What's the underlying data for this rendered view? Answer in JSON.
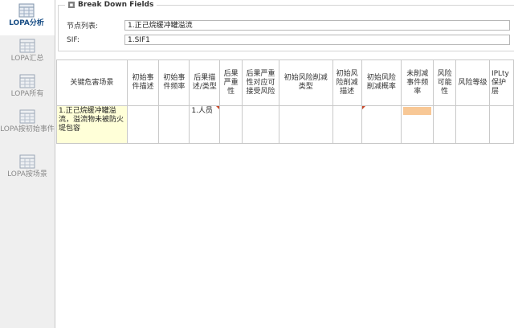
{
  "sidebar": {
    "items": [
      {
        "label": "LOPA分析"
      },
      {
        "label": "LOPA汇总"
      },
      {
        "label": "LOPA所有"
      },
      {
        "label": "LOPA按初始事件"
      },
      {
        "label": "LOPA按场景"
      }
    ]
  },
  "panel": {
    "title": "Break Down Fields",
    "collapse_glyph": "▪",
    "node_label": "节点列表:",
    "node_value": "1.正己烷缓冲罐溢流",
    "sif_label": "SIF:",
    "sif_value": "1.SIF1"
  },
  "table": {
    "headers": [
      "关键危害场景",
      "初始事件描述",
      "初始事件频率",
      "后果描述/类型",
      "后果严重性",
      "后果严重性对应可接受风险",
      "初始风险削减类型",
      "初始风险削减描述",
      "初始风险削减概率",
      "未削减事件频率",
      "风险可能性",
      "风险等级",
      "IPLty保护层"
    ],
    "row": {
      "scenario": "1.正己烷缓冲罐溢流，溢流物未被防火堤包容",
      "consequence": "1.人员"
    }
  }
}
